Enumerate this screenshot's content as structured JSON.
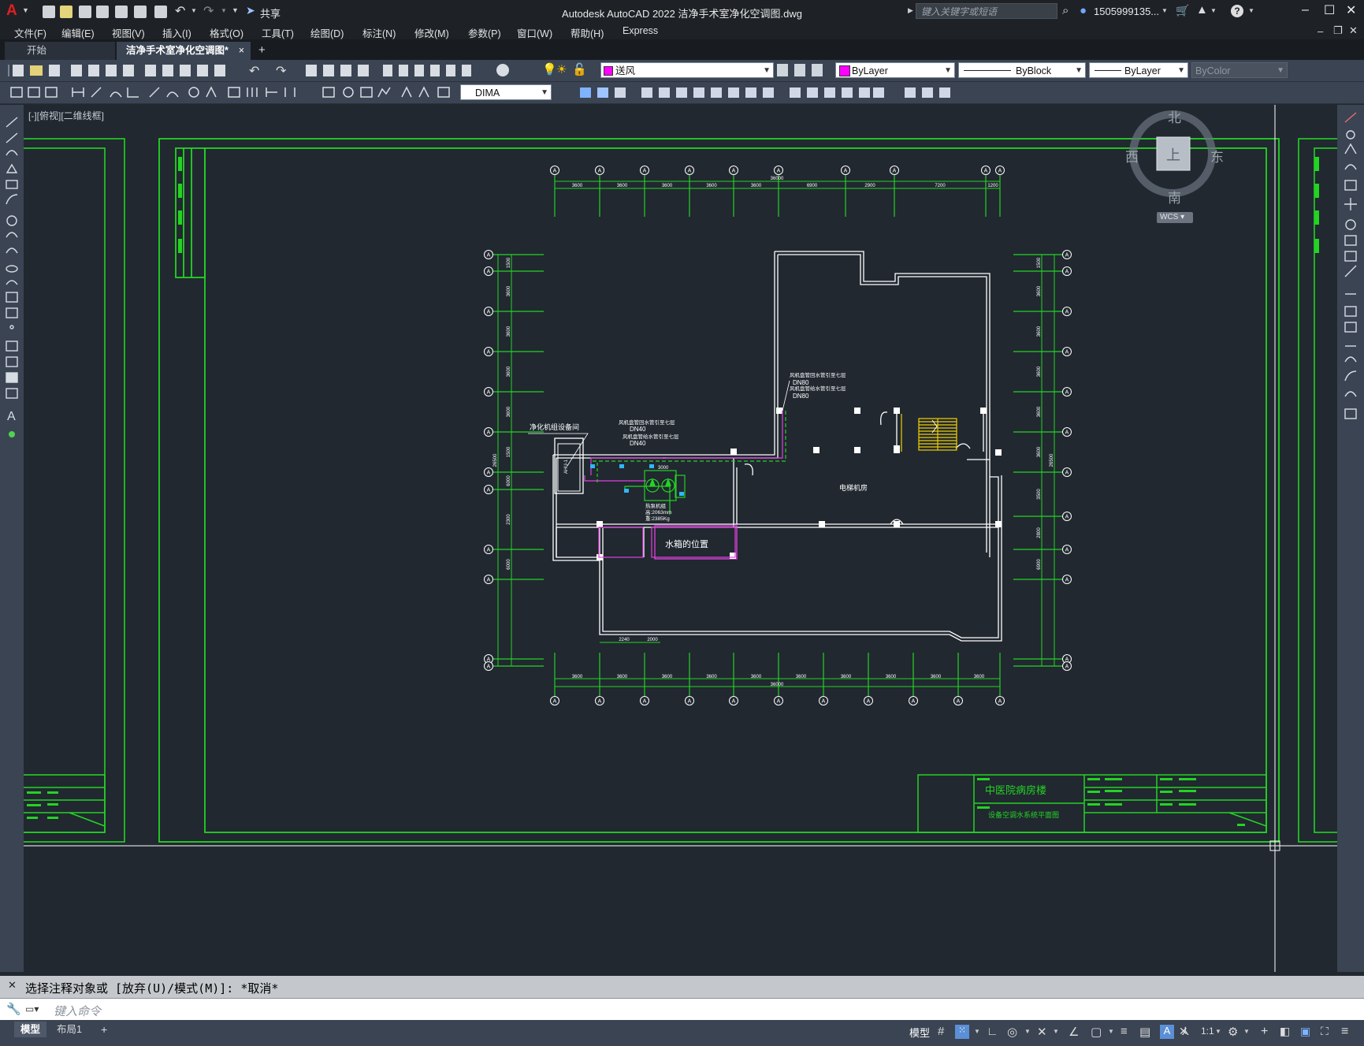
{
  "window": {
    "app_logo": "A",
    "title": "Autodesk AutoCAD 2022    洁净手术室净化空调图.dwg",
    "share_label": "共享",
    "search_placeholder": "键入关键字或短语",
    "user_name": "1505999135...",
    "help_icon": "?"
  },
  "menu": [
    "文件(F)",
    "编辑(E)",
    "视图(V)",
    "插入(I)",
    "格式(O)",
    "工具(T)",
    "绘图(D)",
    "标注(N)",
    "修改(M)",
    "参数(P)",
    "窗口(W)",
    "帮助(H)",
    "Express"
  ],
  "tabs": {
    "start": "开始",
    "active": "洁净手术室净化空调图*",
    "close": "×",
    "add": "+"
  },
  "toolbar": {
    "layer_name": "送风",
    "color": "ByLayer",
    "linetype": "ByBlock",
    "lineweight": "ByLayer",
    "plotstyle": "ByColor",
    "dim_style": "DIMA"
  },
  "viewport": {
    "label": "[-][俯视][二维线框]"
  },
  "viewcube": {
    "north": "北",
    "south": "南",
    "east": "东",
    "west": "西",
    "top": "上",
    "wcs": "WCS"
  },
  "drawing": {
    "grid_bubble": "A",
    "top_dims": [
      "3600",
      "3600",
      "3600",
      "3600",
      "3600",
      "6900",
      "2900",
      "7200",
      "1200"
    ],
    "top_total": "36000",
    "bottom_dims": [
      "3600",
      "3600",
      "3600",
      "3600",
      "3600",
      "3600",
      "3600",
      "3600",
      "3600",
      "3600"
    ],
    "bottom_total": "36000",
    "left_dims": [
      "1500",
      "3600",
      "3600",
      "3600",
      "3600",
      "1500",
      "6000",
      "2300",
      "6000"
    ],
    "left_total": "26500",
    "right_dims": [
      "1500",
      "3600",
      "3600",
      "3600",
      "3600",
      "3600",
      "3500",
      "2800",
      "6900"
    ],
    "right_total": "26500",
    "small_dims": [
      "2240",
      "2000"
    ],
    "labels": {
      "room_equipment": "净化机组设备间",
      "pipe1": "风机盘管回水管引至七层",
      "pipe2": "风机盘管给水管引至七层",
      "pipe3": "风机盘管回水管引至七层",
      "pipe4": "风机盘管给水管引至七层",
      "dn80a": "DN80",
      "dn80b": "DN80",
      "dn40a": "DN40",
      "dn40b": "DN40",
      "ahu": "AHU-1",
      "fan_dim": "3000",
      "chiller": "热泵机组",
      "chiller_spec1": "高:2063mm",
      "chiller_spec2": "重:2385Kg",
      "elevator_room": "电梯机房",
      "water_tank": "水箱的位置"
    },
    "title_block": {
      "project": "中医院病房楼",
      "drawing_name": "设备空调水系统平面图"
    }
  },
  "command": {
    "history": "选择注释对象或 [放弃(U)/模式(M)]: *取消*",
    "placeholder": "键入命令"
  },
  "status": {
    "model_tab": "模型",
    "layout_tab": "布局1",
    "add_tab": "+",
    "model_label": "模型",
    "scale": "1:1"
  }
}
